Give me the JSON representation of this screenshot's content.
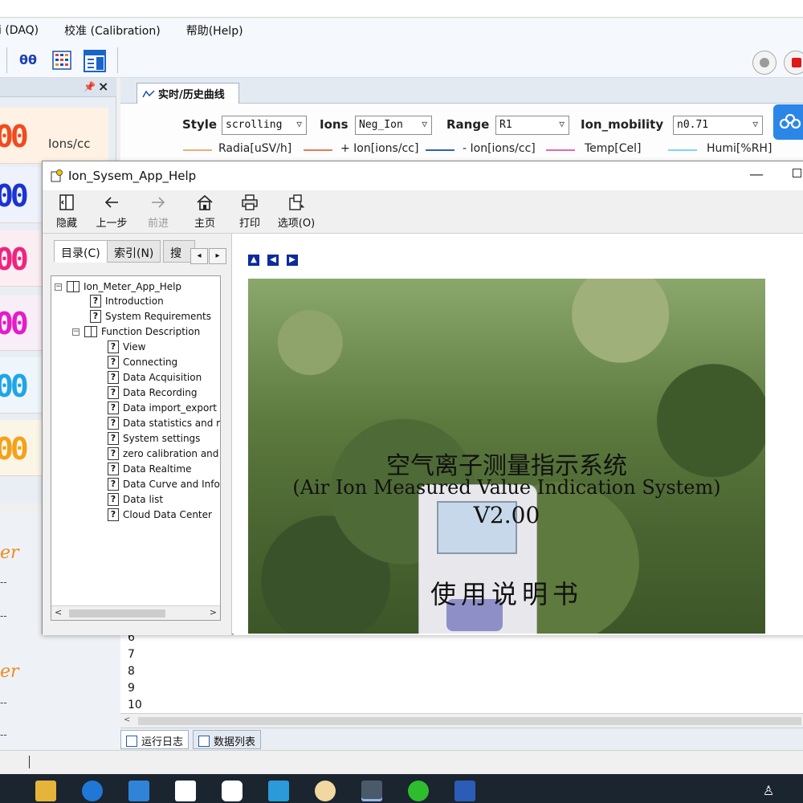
{
  "menu": {
    "items": [
      "i (DAQ)",
      "校准 (Calibration)",
      "帮助(Help)"
    ]
  },
  "toolbar": {
    "oo_icon_text": "θθ"
  },
  "left_panel": {
    "readouts": [
      {
        "digits": "00",
        "unit": "Ions/cc",
        "color": "#f24b1e"
      },
      {
        "digits": "00",
        "unit": "",
        "color": "#1b34d1"
      },
      {
        "digits": "00",
        "unit": "",
        "color": "#f0247f"
      },
      {
        "digits": "00",
        "unit": "",
        "color": "#e51cc8"
      },
      {
        "digits": "00",
        "unit": "",
        "color": "#1fa6e6"
      },
      {
        "digits": "00",
        "unit": "",
        "color": "#f4a218"
      }
    ],
    "fragments": [
      "er",
      "er"
    ]
  },
  "chart": {
    "tab_label": "实时/历史曲线",
    "controls": {
      "style_label": "Style",
      "style_value": "scrolling",
      "ions_label": "Ions",
      "ions_value": "Neg_Ion",
      "range_label": "Range",
      "range_value": "R1",
      "mobility_label": "Ion_mobility",
      "mobility_value": "n0.71"
    },
    "legend": [
      {
        "label": "Radia[uSV/h]",
        "color": "#e7b07a"
      },
      {
        "label": "+ Ion[ions/cc]",
        "color": "#e57a5a"
      },
      {
        "label": "- Ion[ions/cc]",
        "color": "#2f5fc4"
      },
      {
        "label": "Temp[Cel]",
        "color": "#e56aa8"
      },
      {
        "label": "Humi[%RH]",
        "color": "#7ad8ee"
      }
    ]
  },
  "help": {
    "title": "Ion_Sysem_App_Help",
    "toolbar": {
      "hide": "隐藏",
      "back": "上一步",
      "forward": "前进",
      "home": "主页",
      "print": "打印",
      "options": "选项(O)"
    },
    "tabs": {
      "contents": "目录(C)",
      "index": "索引(N)",
      "search": "搜索"
    },
    "tree": {
      "root": "Ion_Meter_App_Help",
      "items": [
        "Introduction",
        "System Requirements"
      ],
      "function_group": "Function Description",
      "function_items": [
        "View",
        "Connecting",
        "Data Acquisition",
        "Data Recording",
        "Data import_export a",
        "Data statistics and r",
        "System settings",
        "zero calibration and",
        "Data Realtime",
        "Data Curve and Infor",
        "Data list",
        "Cloud Data Center"
      ]
    },
    "content": {
      "title_cn": "空气离子测量指示系统",
      "title_en": "(Air Ion Measured Value Indication System)",
      "version": "V2.00",
      "manual": "使用说明书"
    }
  },
  "log": {
    "line_numbers": [
      "6",
      "7",
      "8",
      "9",
      "10"
    ]
  },
  "bottom_tabs": {
    "run_log": "运行日志",
    "data_list": "数据列表"
  }
}
